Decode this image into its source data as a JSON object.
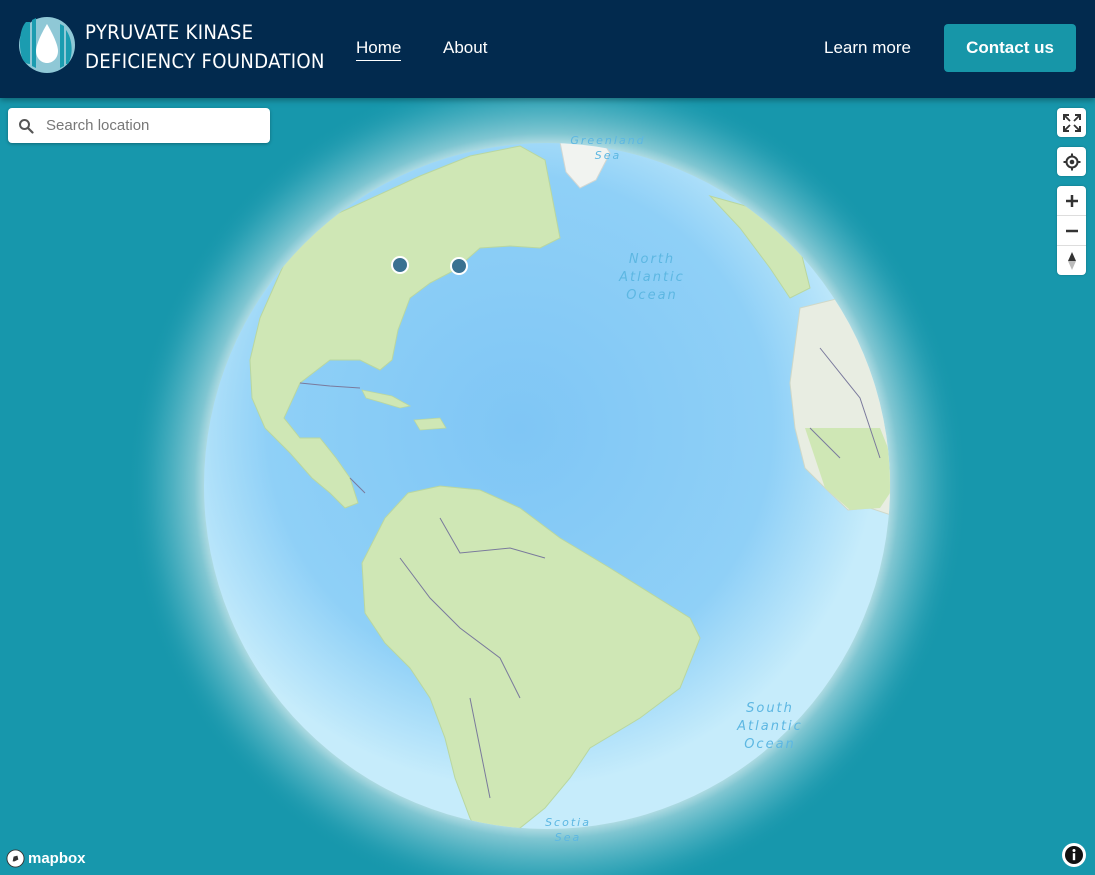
{
  "header": {
    "brand_line1": "PYRUVATE KINASE",
    "brand_line2": "DEFICIENCY FOUNDATION",
    "nav": {
      "home": "Home",
      "about": "About",
      "learn_more": "Learn more"
    },
    "contact_label": "Contact us"
  },
  "search": {
    "placeholder": "Search location"
  },
  "map": {
    "ocean_labels": {
      "greenland_1": "Greenland",
      "greenland_2": "Sea",
      "north_1": "North",
      "north_2": "Atlantic",
      "north_3": "Ocean",
      "south_1": "South",
      "south_2": "Atlantic",
      "south_3": "Ocean",
      "scotia_1": "Scotia",
      "scotia_2": "Sea"
    },
    "markers": [
      "marker-great-lakes",
      "marker-boston"
    ],
    "attribution_brand": "mapbox"
  },
  "controls": [
    "fullscreen-icon",
    "geolocate-icon",
    "zoom-in-icon",
    "zoom-out-icon",
    "compass-icon",
    "info-icon"
  ],
  "colors": {
    "header": "#022a4e",
    "accent": "#1796a8",
    "map_bg": "#1797ac",
    "ocean": "#8fd0f5",
    "land": "#cfe7b5",
    "marker": "#3a7191"
  }
}
